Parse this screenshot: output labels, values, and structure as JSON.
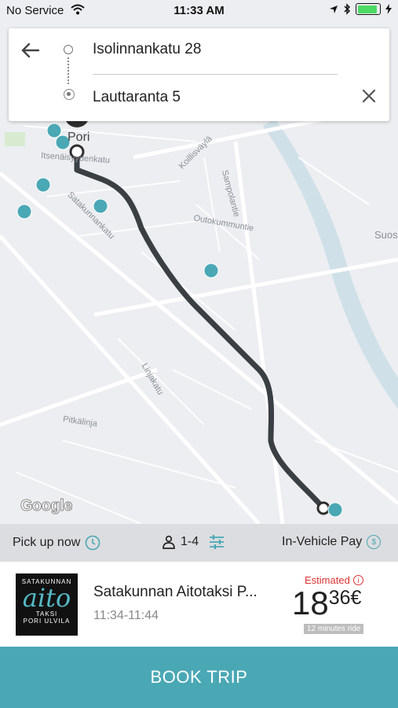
{
  "status_bar": {
    "carrier": "No Service",
    "time": "11:33 AM"
  },
  "map": {
    "labels": [
      "Pori",
      "Itsenäisyydenkatu",
      "Satakunnankatu",
      "Koillisväylä",
      "Sampolantie",
      "Outokummuntie",
      "Linjakatu",
      "Pitkälinja",
      "Suos"
    ],
    "attribution": "Google",
    "route_color": "#3a3f43",
    "marker_color": "#4aa8b5"
  },
  "search": {
    "from": "Isolinnankatu 28",
    "to": "Lauttaranta 5"
  },
  "options": {
    "pickup": "Pick up now",
    "passengers": "1-4",
    "payment": "In-Vehicle Pay"
  },
  "result": {
    "logo": {
      "line1": "SATAKUNNAN",
      "line2": "aito",
      "line3": "TAKSI",
      "line4": "PORI ULVILA"
    },
    "name": "Satakunnan Aitotaksi P...",
    "time_window": "11:34-11:44",
    "estimated_label": "Estimated",
    "price_main": "18",
    "price_cents": "36€",
    "ride_duration": "12 minutes ride"
  },
  "book_button": "BOOK TRIP",
  "colors": {
    "accent": "#4aa8b5",
    "estimate": "#dd3333"
  }
}
